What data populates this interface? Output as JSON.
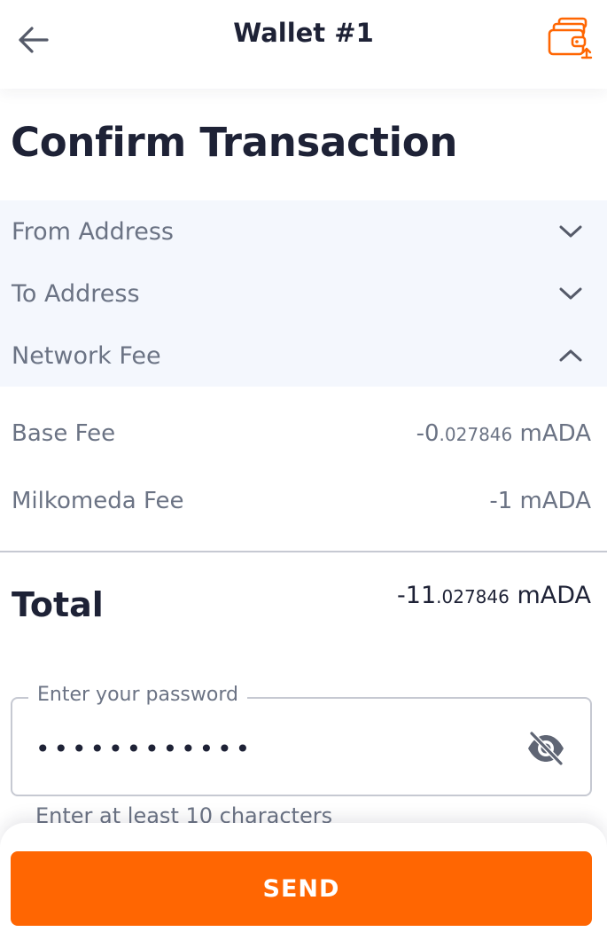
{
  "header": {
    "title": "Wallet #1",
    "back_icon": "arrow-left-icon",
    "wallet_icon": "wallet-switch-icon"
  },
  "page_title": "Confirm Transaction",
  "accordion": [
    {
      "label": "From Address",
      "state": "collapsed"
    },
    {
      "label": "To Address",
      "state": "collapsed"
    },
    {
      "label": "Network Fee",
      "state": "expanded"
    }
  ],
  "fees": {
    "base": {
      "label": "Base Fee",
      "int": "-0",
      "dec": ".027846",
      "unit": " mADA"
    },
    "milkomeda": {
      "label": "Milkomeda Fee",
      "int": "-1",
      "dec": "",
      "unit": " mADA"
    }
  },
  "total": {
    "label": "Total",
    "int": "-11",
    "dec": ".027846",
    "unit": " mADA"
  },
  "password": {
    "label": "Enter your password",
    "value": "••••••••••••",
    "helper": "Enter at least 10 characters"
  },
  "send_label": "SEND",
  "colors": {
    "accent": "#ff6602",
    "text": "#1e2236",
    "muted": "#6b7384",
    "accordion_bg": "#f4f7fd"
  }
}
